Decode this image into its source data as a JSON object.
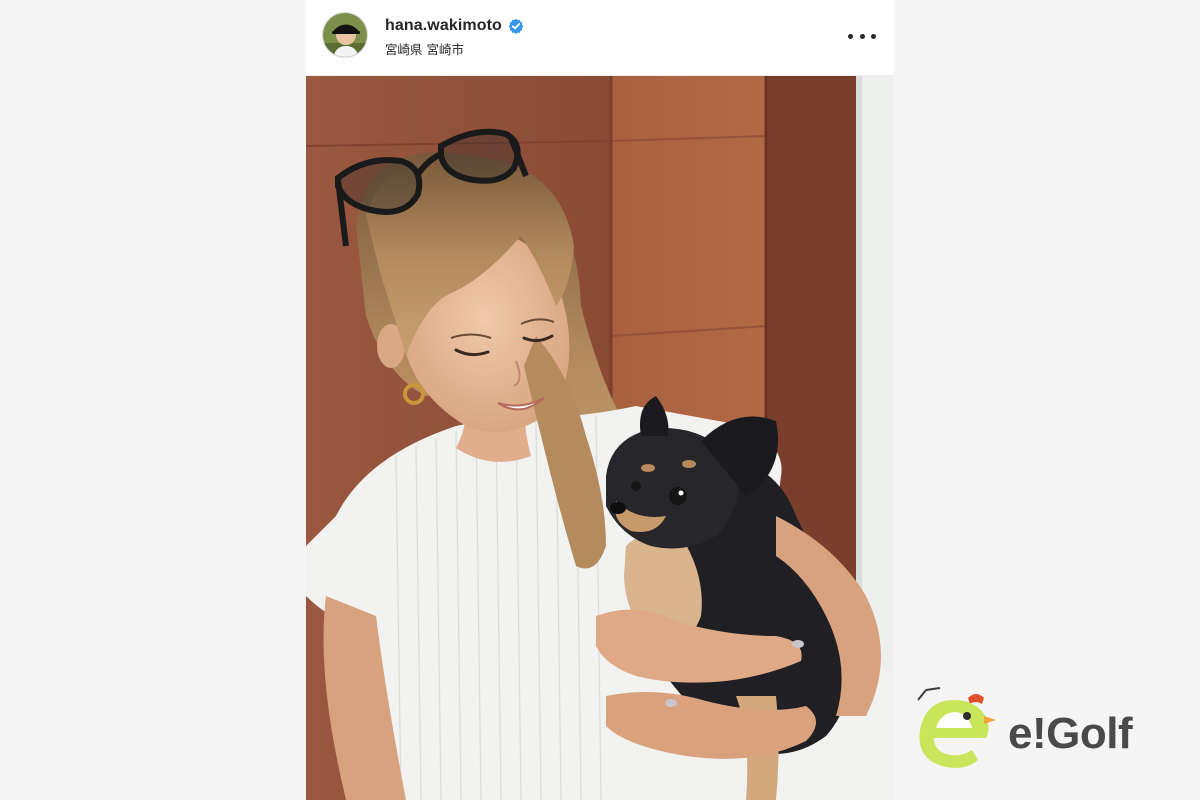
{
  "post": {
    "username": "hana.wakimoto",
    "location": "宮崎県 宮崎市",
    "verified": true,
    "photo_subject": "woman-holding-chihuahua"
  },
  "icons": {
    "verified": "verified-badge-icon",
    "more": "more-options-icon",
    "avatar": "profile-avatar"
  },
  "watermark": {
    "brand": "e!Golf"
  },
  "colors": {
    "page_background": "#f5f5f5",
    "verified_blue": "#3897f0",
    "text_dark": "#262626",
    "brand_green": "#c9e65a",
    "brand_gray": "#4a4a4a"
  }
}
